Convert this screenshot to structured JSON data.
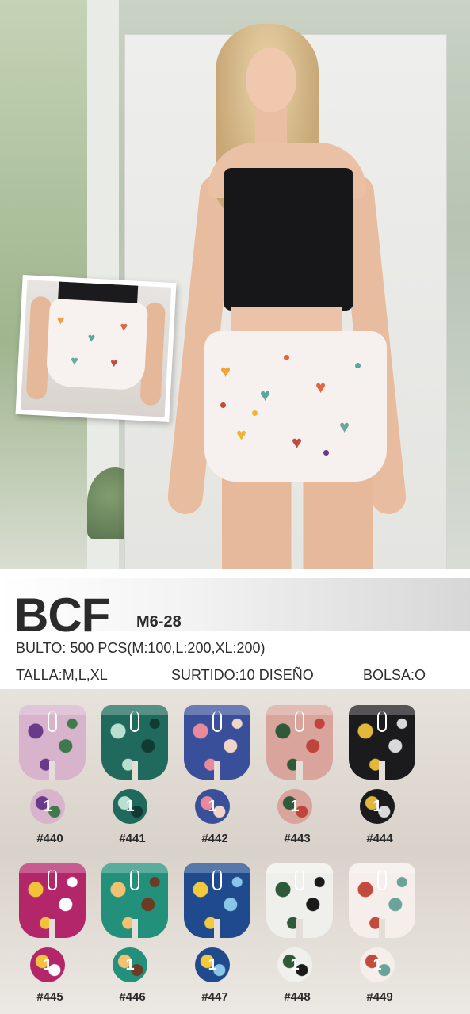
{
  "brand": "BCF",
  "model_code": "M6-28",
  "bulto": "BULTO: 500 PCS(M:100,L:200,XL:200)",
  "talla": "TALLA:M,L,XL",
  "surtido": "SURTIDO:10 DISEÑO",
  "bolsa": "BOLSA:O",
  "colors": {
    "shorts_main": "#f6f1ee",
    "top": "#17171a",
    "text": "#2b2b2b"
  },
  "designs": [
    {
      "label": "#440",
      "count": "1",
      "base": "#d7b3cc",
      "accent": "#6a3a8a",
      "accent2": "#3f7a4c"
    },
    {
      "label": "#441",
      "count": "1",
      "base": "#1f6a5c",
      "accent": "#b9e0cf",
      "accent2": "#0f3b33"
    },
    {
      "label": "#442",
      "count": "1",
      "base": "#3a4f9a",
      "accent": "#e88a9c",
      "accent2": "#f0d6c6"
    },
    {
      "label": "#443",
      "count": "1",
      "base": "#d8a49c",
      "accent": "#2f5a3a",
      "accent2": "#c0443a"
    },
    {
      "label": "#444",
      "count": "1",
      "base": "#1b1b1e",
      "accent": "#e3b83a",
      "accent2": "#d9d9d9"
    },
    {
      "label": "#445",
      "count": "1",
      "base": "#b3266a",
      "accent": "#f2c23a",
      "accent2": "#ffffff"
    },
    {
      "label": "#446",
      "count": "1",
      "base": "#23907b",
      "accent": "#f1c272",
      "accent2": "#6b3b24"
    },
    {
      "label": "#447",
      "count": "1",
      "base": "#1f4b8e",
      "accent": "#f3c93d",
      "accent2": "#8ac7e6"
    },
    {
      "label": "#448",
      "count": "1",
      "base": "#efefeb",
      "accent": "#2e5a3a",
      "accent2": "#1a1a1a"
    },
    {
      "label": "#449",
      "count": "1",
      "base": "#f5eeea",
      "accent": "#c24b3d",
      "accent2": "#6aa39a"
    }
  ]
}
